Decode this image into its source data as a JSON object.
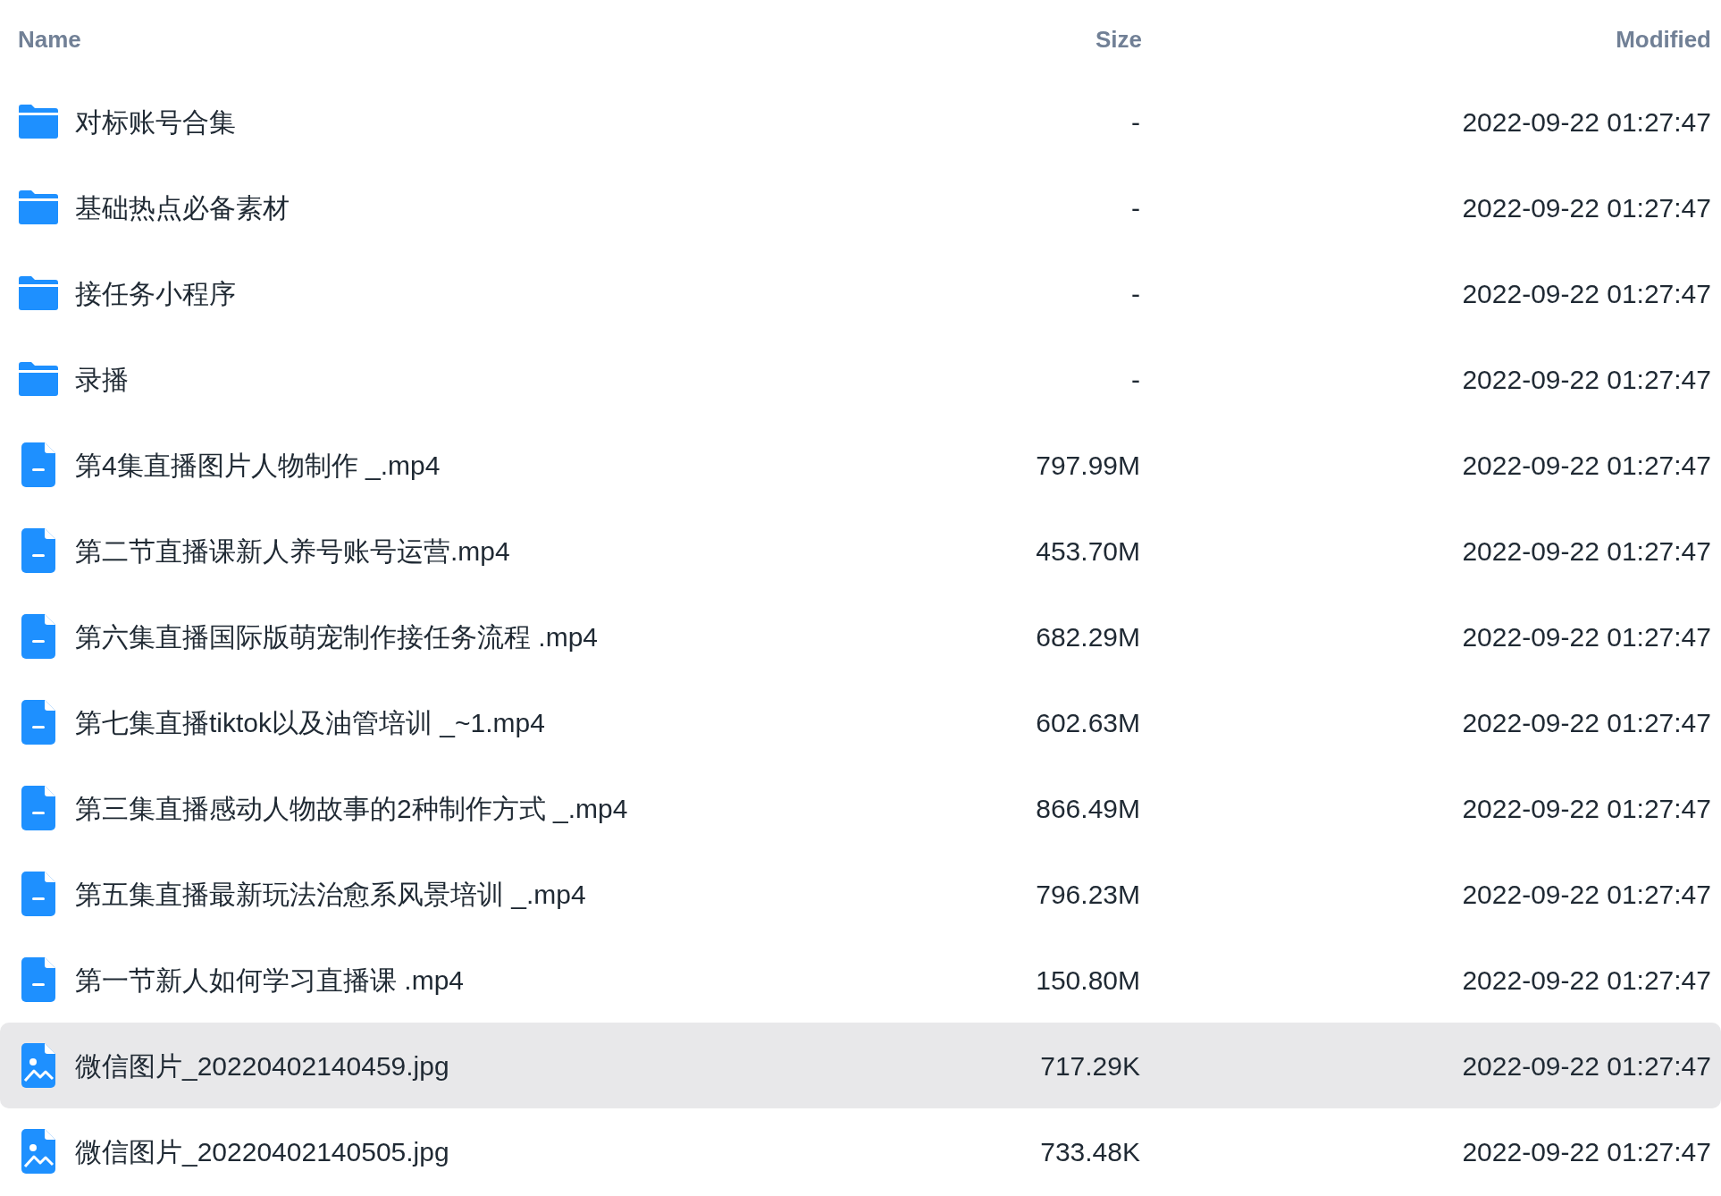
{
  "columns": [
    "Name",
    "Size",
    "Modified"
  ],
  "rows": [
    {
      "kind": "folder",
      "name": "对标账号合集",
      "size": "-",
      "modified": "2022-09-22 01:27:47",
      "selected": false
    },
    {
      "kind": "folder",
      "name": "基础热点必备素材",
      "size": "-",
      "modified": "2022-09-22 01:27:47",
      "selected": false
    },
    {
      "kind": "folder",
      "name": "接任务小程序",
      "size": "-",
      "modified": "2022-09-22 01:27:47",
      "selected": false
    },
    {
      "kind": "folder",
      "name": "录播",
      "size": "-",
      "modified": "2022-09-22 01:27:47",
      "selected": false
    },
    {
      "kind": "file",
      "name": "第4集直播图片人物制作 _.mp4",
      "size": "797.99M",
      "modified": "2022-09-22 01:27:47",
      "selected": false
    },
    {
      "kind": "file",
      "name": "第二节直播课新人养号账号运营.mp4",
      "size": "453.70M",
      "modified": "2022-09-22 01:27:47",
      "selected": false
    },
    {
      "kind": "file",
      "name": "第六集直播国际版萌宠制作接任务流程 .mp4",
      "size": "682.29M",
      "modified": "2022-09-22 01:27:47",
      "selected": false
    },
    {
      "kind": "file",
      "name": "第七集直播tiktok以及油管培训 _~1.mp4",
      "size": "602.63M",
      "modified": "2022-09-22 01:27:47",
      "selected": false
    },
    {
      "kind": "file",
      "name": "第三集直播感动人物故事的2种制作方式 _.mp4",
      "size": "866.49M",
      "modified": "2022-09-22 01:27:47",
      "selected": false
    },
    {
      "kind": "file",
      "name": "第五集直播最新玩法治愈系风景培训 _.mp4",
      "size": "796.23M",
      "modified": "2022-09-22 01:27:47",
      "selected": false
    },
    {
      "kind": "file",
      "name": "第一节新人如何学习直播课 .mp4",
      "size": "150.80M",
      "modified": "2022-09-22 01:27:47",
      "selected": false
    },
    {
      "kind": "image",
      "name": "微信图片_20220402140459.jpg",
      "size": "717.29K",
      "modified": "2022-09-22 01:27:47",
      "selected": true
    },
    {
      "kind": "image",
      "name": "微信图片_20220402140505.jpg",
      "size": "733.48K",
      "modified": "2022-09-22 01:27:47",
      "selected": false
    }
  ]
}
